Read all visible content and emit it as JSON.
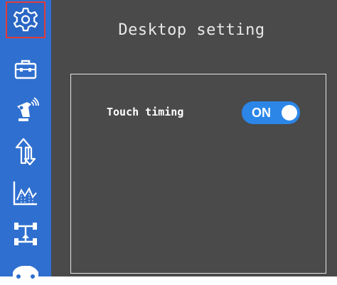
{
  "sidebar": {
    "items": [
      {
        "icon": "gear-icon",
        "selected": true
      },
      {
        "icon": "toolbox-icon",
        "selected": false
      },
      {
        "icon": "radio-transmitter-icon",
        "selected": false
      },
      {
        "icon": "up-down-arrows-icon",
        "selected": false
      },
      {
        "icon": "line-chart-icon",
        "selected": false
      },
      {
        "icon": "chassis-icon",
        "selected": false
      },
      {
        "icon": "car-icon",
        "selected": false
      }
    ],
    "selected_border_color": "#e23b3b",
    "background_color": "#2f6fcf"
  },
  "main": {
    "title": "Desktop setting",
    "settings": [
      {
        "label": "Touch timing",
        "toggle_text": "ON",
        "enabled": true
      }
    ],
    "toggle_on_color": "#2c86e8",
    "background_color": "#4a4a4a"
  }
}
